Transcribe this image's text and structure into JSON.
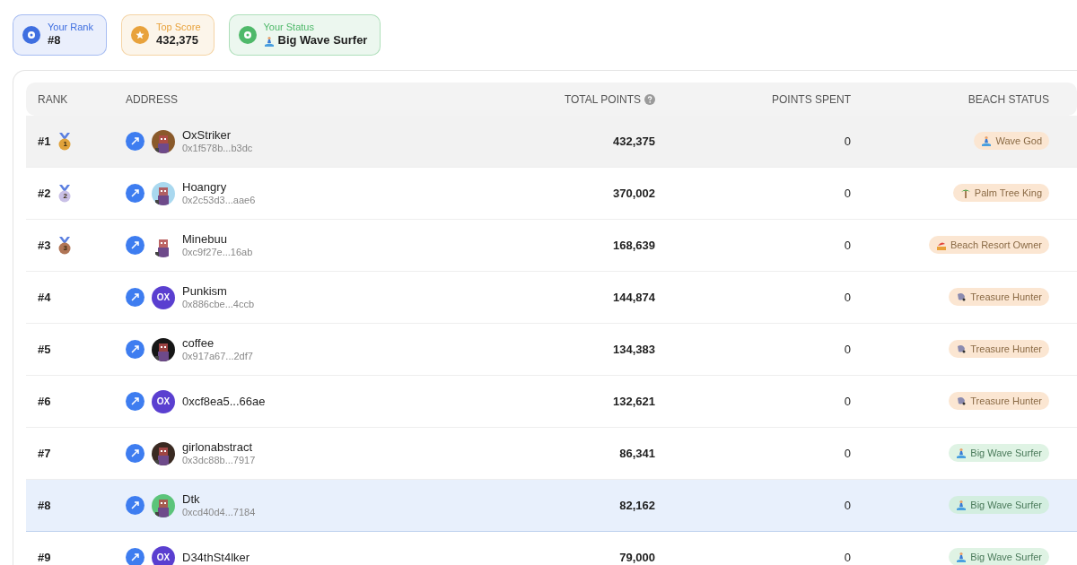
{
  "summary_cards": [
    {
      "kind": "rank",
      "label": "Your Rank",
      "value": "#8",
      "color": "#3f6fe0"
    },
    {
      "kind": "score",
      "label": "Top Score",
      "value": "432,375",
      "color": "#e8a23c"
    },
    {
      "kind": "status",
      "label": "Your Status",
      "value": "Big Wave Surfer",
      "color": "#4fb96a"
    }
  ],
  "table": {
    "columns": [
      "RANK",
      "ADDRESS",
      "TOTAL POINTS",
      "POINTS SPENT",
      "BEACH STATUS"
    ],
    "rows": [
      {
        "rank": "#1",
        "medal": {
          "label": "1",
          "color": "#e0a23a"
        },
        "name": "OxStriker",
        "address": "0x1f578b...b3dc",
        "total": "432,375",
        "spent": "0",
        "status": {
          "label": "Wave God",
          "kind": "surfer",
          "color": "#fbe6d2"
        },
        "selected": false,
        "highlighted": true
      },
      {
        "rank": "#2",
        "medal": {
          "label": "2",
          "color": "#c9c0e6"
        },
        "name": "Hoangry",
        "address": "0x2c53d3...aae6",
        "total": "370,002",
        "spent": "0",
        "status": {
          "label": "Palm Tree King",
          "kind": "palm",
          "color": "#fbe6d2"
        },
        "selected": false,
        "highlighted": false
      },
      {
        "rank": "#3",
        "medal": {
          "label": "3",
          "color": "#b07556"
        },
        "name": "Minebuu",
        "address": "0xc9f27e...16ab",
        "total": "168,639",
        "spent": "0",
        "status": {
          "label": "Beach Resort Owner",
          "kind": "resort",
          "color": "#fbe6d2"
        },
        "selected": false,
        "highlighted": false
      },
      {
        "rank": "#4",
        "avatar": {
          "kind": "initials",
          "text": "OX",
          "color": "#5a3fd0"
        },
        "name": "Punkism",
        "address": "0x886cbe...4ccb",
        "total": "144,874",
        "spent": "0",
        "status": {
          "label": "Treasure Hunter",
          "kind": "shell",
          "color": "#fbe6d2"
        },
        "selected": false,
        "highlighted": false
      },
      {
        "rank": "#5",
        "name": "coffee",
        "address": "0x917a67...2df7",
        "total": "134,383",
        "spent": "0",
        "status": {
          "label": "Treasure Hunter",
          "kind": "shell",
          "color": "#fbe6d2"
        },
        "selected": false,
        "highlighted": false
      },
      {
        "rank": "#6",
        "avatar": {
          "kind": "initials",
          "text": "OX",
          "color": "#5a3fd0"
        },
        "name": "0xcf8ea5...66ae",
        "total": "132,621",
        "spent": "0",
        "status": {
          "label": "Treasure Hunter",
          "kind": "shell",
          "color": "#fbe6d2"
        },
        "selected": false,
        "highlighted": false
      },
      {
        "rank": "#7",
        "name": "girlonabstract",
        "address": "0x3dc88b...7917",
        "total": "86,341",
        "spent": "0",
        "status": {
          "label": "Big Wave Surfer",
          "kind": "surfer",
          "color": "#dff3e4"
        },
        "selected": false,
        "highlighted": false
      },
      {
        "rank": "#8",
        "name": "Dtk",
        "address": "0xcd40d4...7184",
        "total": "82,162",
        "spent": "0",
        "status": {
          "label": "Big Wave Surfer",
          "kind": "surfer",
          "color": "#d3eee0"
        },
        "selected": true,
        "highlighted": false
      },
      {
        "rank": "#9",
        "avatar": {
          "kind": "initials",
          "text": "OX",
          "color": "#5a3fd0"
        },
        "name": "D34thSt4lker",
        "total": "79,000",
        "spent": "0",
        "status": {
          "label": "Big Wave Surfer",
          "kind": "surfer",
          "color": "#dff3e4"
        },
        "selected": false,
        "highlighted": false
      }
    ]
  }
}
